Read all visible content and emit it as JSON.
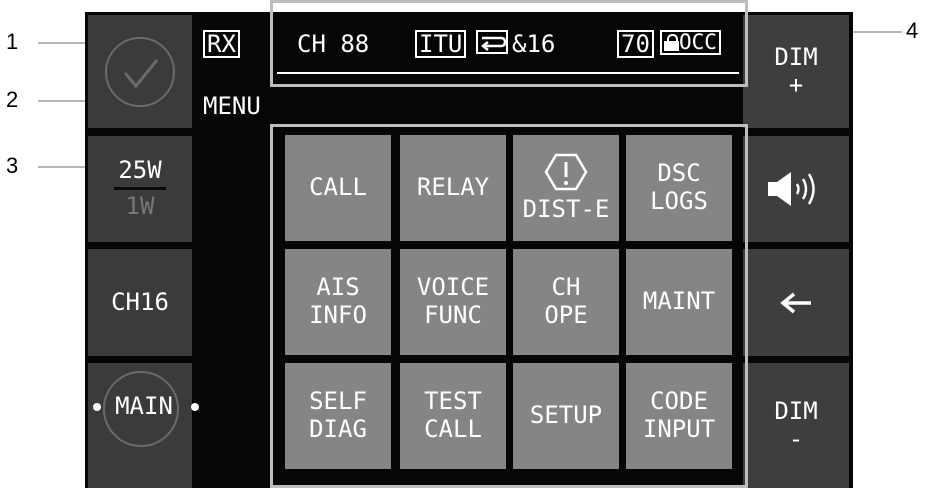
{
  "callouts": [
    "1",
    "2",
    "3",
    "4"
  ],
  "left_panel": {
    "check_icon": "check-icon",
    "power_high": "25W",
    "power_low": "1W",
    "ch16": "CH16",
    "main": "MAIN"
  },
  "status_bar": {
    "rx": "RX",
    "channel": "CH 88",
    "itu": "ITU",
    "dual_watch": "&16",
    "number": "70",
    "occ": "OCC"
  },
  "menu_label": "MENU",
  "menu_grid": [
    {
      "lines": [
        "CALL"
      ]
    },
    {
      "lines": [
        "RELAY"
      ]
    },
    {
      "lines": [
        "DIST-E"
      ],
      "icon": "distress-warning-icon"
    },
    {
      "lines": [
        "DSC",
        "LOGS"
      ]
    },
    {
      "lines": [
        "AIS",
        "INFO"
      ]
    },
    {
      "lines": [
        "VOICE",
        "FUNC"
      ]
    },
    {
      "lines": [
        "CH",
        "OPE"
      ]
    },
    {
      "lines": [
        "MAINT"
      ]
    },
    {
      "lines": [
        "SELF",
        "DIAG"
      ]
    },
    {
      "lines": [
        "TEST",
        "CALL"
      ]
    },
    {
      "lines": [
        "SETUP"
      ]
    },
    {
      "lines": [
        "CODE",
        "INPUT"
      ]
    }
  ],
  "right_panel": {
    "dim_plus": [
      "DIM",
      "+"
    ],
    "volume_icon": "speaker-icon",
    "back_icon": "back-arrow-icon",
    "dim_minus": [
      "DIM",
      "-"
    ]
  },
  "colors": {
    "background": "#060606",
    "side_tile": "#3b3b3b",
    "menu_button": "#858585",
    "callout_frame": "#bdbdbd"
  }
}
